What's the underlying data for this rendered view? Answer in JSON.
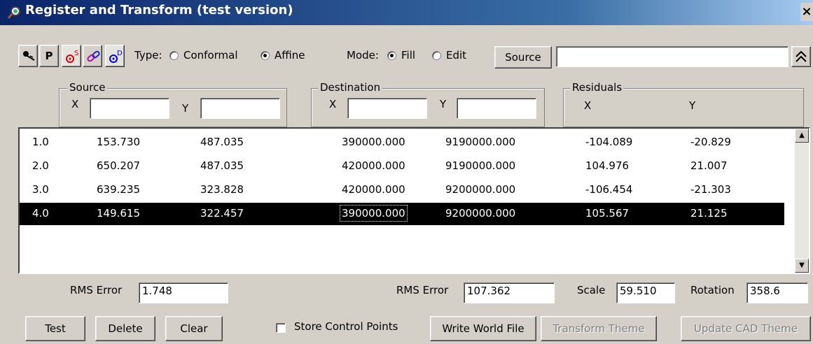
{
  "window": {
    "title": "Register and Transform (test version)",
    "close_label": "×"
  },
  "toolbar": {
    "tools": [
      {
        "name": "pin-tool",
        "label": ""
      },
      {
        "name": "p-tool",
        "label": "P"
      },
      {
        "name": "source-link-tool",
        "label": "S"
      },
      {
        "name": "link-tool",
        "label": ""
      },
      {
        "name": "destination-link-tool",
        "label": "D"
      }
    ],
    "type_label": "Type:",
    "type_options": [
      "Conformal",
      "Affine"
    ],
    "type_selected": "Affine",
    "mode_label": "Mode:",
    "mode_options": [
      "Fill",
      "Edit"
    ],
    "mode_selected": "Fill",
    "source_button": "Source",
    "source_value": "",
    "collapse_icon": "double-chevron-up-icon"
  },
  "groups": {
    "source": {
      "title": "Source",
      "x_label": "X",
      "y_label": "Y",
      "x_value": "",
      "y_value": ""
    },
    "destination": {
      "title": "Destination",
      "x_label": "X",
      "y_label": "Y",
      "x_value": "",
      "y_value": ""
    },
    "residuals": {
      "title": "Residuals",
      "x_label": "X",
      "y_label": "Y"
    }
  },
  "rows": [
    {
      "id": "1.0",
      "src_x": "153.730",
      "src_y": "487.035",
      "dst_x": "390000.000",
      "dst_y": "9190000.000",
      "res_x": "-104.089",
      "res_y": "-20.829"
    },
    {
      "id": "2.0",
      "src_x": "650.207",
      "src_y": "487.035",
      "dst_x": "420000.000",
      "dst_y": "9190000.000",
      "res_x": "104.976",
      "res_y": "21.007"
    },
    {
      "id": "3.0",
      "src_x": "639.235",
      "src_y": "323.828",
      "dst_x": "420000.000",
      "dst_y": "9200000.000",
      "res_x": "-106.454",
      "res_y": "-21.303"
    },
    {
      "id": "4.0",
      "src_x": "149.615",
      "src_y": "322.457",
      "dst_x": "390000.000",
      "dst_y": "9200000.000",
      "res_x": "105.567",
      "res_y": "21.125"
    }
  ],
  "selected_row": "4.0",
  "stats": {
    "rms_label_1": "RMS Error",
    "rms_value_1": "1.748",
    "rms_label_2": "RMS Error",
    "rms_value_2": "107.362",
    "scale_label": "Scale",
    "scale_value": "59.510",
    "rotation_label": "Rotation",
    "rotation_value": "358.6"
  },
  "actions": {
    "test": "Test",
    "delete": "Delete",
    "clear": "Clear",
    "store_control_points": "Store Control Points",
    "store_checked": false,
    "write_world_file": "Write World File",
    "transform_theme": "Transform Theme",
    "update_cad_theme": "Update CAD Theme"
  }
}
